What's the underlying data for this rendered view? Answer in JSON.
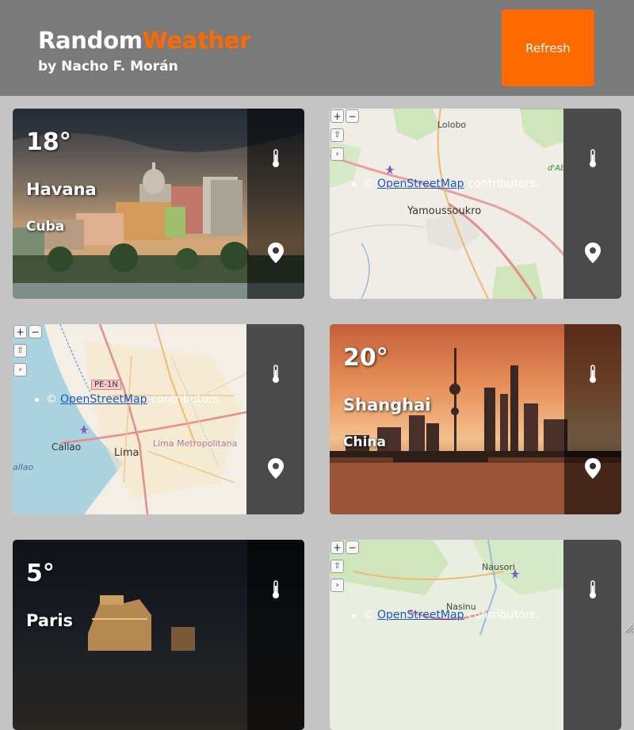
{
  "header": {
    "brand_part1": "Random",
    "brand_part2": "Weather",
    "byline": "by Nacho F. Morán",
    "refresh_label": "Refresh"
  },
  "colors": {
    "accent": "#ff6a00",
    "header_bg": "#7a7a7a",
    "page_bg": "#c4c4c4",
    "panel_dark": "#4a4a4a"
  },
  "cards": {
    "havana": {
      "temp": "18°",
      "city": "Havana",
      "country": "Cuba",
      "view": "photo"
    },
    "yamoussoukro": {
      "view": "map",
      "zoom_in": "+",
      "zoom_out": "−",
      "home": "⇧",
      "expand": "›",
      "attribution_copy": "©",
      "attribution_link": "OpenStreetMap",
      "attribution_suffix": "contributors.",
      "labels": {
        "top": "Lolobo",
        "city": "Yamoussoukro",
        "edge": "d'Ab"
      }
    },
    "lima": {
      "view": "map",
      "zoom_in": "+",
      "zoom_out": "−",
      "home": "⇧",
      "expand": "›",
      "attribution_copy": "©",
      "attribution_link": "OpenStreetMap",
      "attribution_suffix": "contributors.",
      "labels": {
        "road": "PE-1N",
        "port": "Callao",
        "city": "Lima",
        "region": "Lima Metropolitana",
        "coast": "allao"
      }
    },
    "shanghai": {
      "temp": "20°",
      "city": "Shanghai",
      "country": "China",
      "view": "photo"
    },
    "paris": {
      "temp": "5°",
      "city": "Paris",
      "view": "photo"
    },
    "suva": {
      "view": "map",
      "zoom_in": "+",
      "zoom_out": "−",
      "home": "⇧",
      "expand": "›",
      "attribution_copy": "©",
      "attribution_link": "OpenStreetMap",
      "attribution_suffix": "contributors.",
      "labels": {
        "top": "Nausori",
        "mid": "Nasinu"
      }
    }
  },
  "icons": {
    "temperature": "thermometer-icon",
    "location": "map-pin-icon",
    "airport": "airport-icon"
  }
}
